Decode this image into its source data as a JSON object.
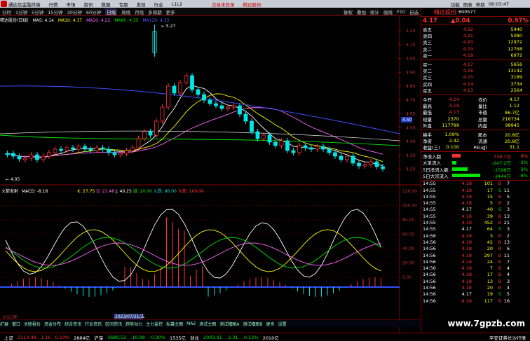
{
  "topbar": {
    "title": "通达信金融终端",
    "menus": [
      "行情",
      "市场",
      "资讯",
      "数据",
      "专题",
      "发现",
      "行业",
      "L1L2"
    ],
    "promo1": "交易未登录",
    "promo2": "精达股份",
    "right": [
      "功能",
      "图表",
      "帮助"
    ],
    "time": "08:03:47"
  },
  "toolbar": {
    "items": [
      "分时",
      "1分钟",
      "5分钟",
      "15分钟",
      "30分钟",
      "60分钟",
      "日线",
      "周线",
      "月线",
      "多周期",
      "更多"
    ],
    "active": "日线",
    "right": [
      "复权",
      "叠加",
      "统计",
      "画线",
      "F10",
      "自选"
    ]
  },
  "info": {
    "name": "精达股份(日线)",
    "ma5": "MA5: 4.14",
    "ma10": "MA10: 4.17",
    "ma20": "MA20: 4.22",
    "ma60": "MA60: 4.35",
    "ma120": "MA120: 4.33"
  },
  "macd_info": {
    "name": "火箭发射",
    "macd": "MACD: -8.18",
    "k": "K: 27.75",
    "d": "D: 21.48",
    "j": "J: 40.25",
    "r1": "减: 20.00",
    "r2": "入跌: 80.00",
    "r3": "大跌: 100.00"
  },
  "chart_data": {
    "type": "candlestick",
    "y_ticks": [
      "5.20",
      "5.10",
      "5.00",
      "4.90",
      "4.80",
      "4.70",
      "4.60",
      "4.50",
      "4.40",
      "4.30",
      "4.20",
      "4.10"
    ],
    "high_label": "5.27",
    "low_label": "4.05",
    "current": "4.50",
    "osc_ticks": [
      "120.00",
      "100.00",
      "80.00",
      "60.00",
      "40.00",
      "20.00",
      "0.00"
    ],
    "dates": [
      "2023年",
      "2023/07/21/五"
    ]
  },
  "quote": {
    "code": "600577",
    "name": "精达股份",
    "price": "4.17",
    "change": "▲0.04",
    "pct": "0.97%",
    "sells": [
      [
        "卖五",
        "4.22",
        "5440"
      ],
      [
        "卖四",
        "4.21",
        "5080"
      ],
      [
        "卖三",
        "4.20",
        "12972"
      ],
      [
        "卖二",
        "4.19",
        "12768"
      ],
      [
        "卖一",
        "4.18",
        "6972"
      ]
    ],
    "buys": [
      [
        "买一",
        "4.17",
        "5656"
      ],
      [
        "买二",
        "4.16",
        "13142"
      ],
      [
        "买三",
        "4.15",
        "3189"
      ],
      [
        "买四",
        "4.14",
        "3734"
      ],
      [
        "买五",
        "4.13",
        "2564"
      ]
    ],
    "stats": [
      [
        "今开",
        "4.14",
        "均价",
        "4.17"
      ],
      [
        "最高",
        "4.19",
        "量比",
        "1.12"
      ],
      [
        "最低",
        "4.13",
        "市值",
        "86.7亿"
      ],
      [
        "现量",
        "2370",
        "总量",
        "216734"
      ],
      [
        "外盘",
        "117789",
        "内盘",
        "98945"
      ]
    ],
    "stats2": [
      [
        "换手",
        "1.09%",
        "股本",
        "20.8亿"
      ],
      [
        "净资",
        "2.42",
        "流通",
        "20.8亿"
      ],
      [
        "收益(三)",
        "0.100",
        "PE(动)",
        "31.1"
      ]
    ],
    "flows": [
      [
        "净流入额",
        "739.7万",
        "8%"
      ],
      [
        "大单流入",
        "-247.2万",
        "-3%"
      ],
      [
        "5日净流入额",
        "-1598万",
        "-3%"
      ],
      [
        "5日大宗流入",
        "-3444万",
        "-8%"
      ]
    ],
    "ticks": [
      [
        "14:55",
        "4.18",
        "101",
        "B",
        "7"
      ],
      [
        "14:55",
        "4.18",
        "17",
        "S",
        "11"
      ],
      [
        "14:55",
        "4.18",
        "15",
        "B",
        "5"
      ],
      [
        "14:55",
        "4.18",
        "5",
        "B",
        "2"
      ],
      [
        "14:55",
        "4.17",
        "40",
        "S",
        "3"
      ],
      [
        "14:55",
        "4.18",
        "39",
        "B",
        "13"
      ],
      [
        "14:55",
        "4.18",
        "452",
        "B",
        "21"
      ],
      [
        "14:55",
        "4.17",
        "64",
        "S",
        "3"
      ],
      [
        "14:56",
        "4.18",
        "3",
        "B",
        "2"
      ],
      [
        "14:56",
        "4.18",
        "42",
        "B",
        "13"
      ],
      [
        "14:56",
        "4.18",
        "20",
        "B",
        "6"
      ],
      [
        "14:56",
        "4.18",
        "297",
        "B",
        "11"
      ],
      [
        "14:56",
        "4.18",
        "24",
        "B",
        "7"
      ],
      [
        "14:56",
        "4.18",
        "7",
        "B",
        "4"
      ],
      [
        "14:56",
        "4.18",
        "17",
        "B",
        "4"
      ],
      [
        "14:56",
        "4.18",
        "13",
        "B",
        "3"
      ],
      [
        "14:56",
        "4.18",
        "20",
        "B",
        "4"
      ],
      [
        "14:56",
        "4.17",
        "19",
        "S",
        "5"
      ],
      [
        "14:56",
        "4.18",
        "117",
        "B",
        "16"
      ]
    ]
  },
  "tabs": [
    "扩展",
    "窗口",
    "关联报价",
    "资金分布",
    "综合资讯",
    "行业资讯",
    "区间资讯",
    "趋势动力",
    "主力监控",
    "私募主图",
    "MA2",
    "测试主图",
    "测试幅图A",
    "测试幅图B",
    "更多",
    "设置"
  ],
  "bottom": {
    "idx1": "上证",
    "v1": "3110.48",
    "c1": "3.16",
    "p1": "0.10%",
    "a1": "2884亿",
    "idx2": "沪深",
    "v2": "3689.52",
    "c2": "-10.98",
    "p2": "-0.30%",
    "a2": "1535亿",
    "idx3": "创业",
    "v3": "2003.91",
    "c3": "-2.31",
    "p3": "-0.12%",
    "a3": "2010亿",
    "status": "平安证券长沙行情"
  },
  "watermark": "www.7gpzb.com"
}
